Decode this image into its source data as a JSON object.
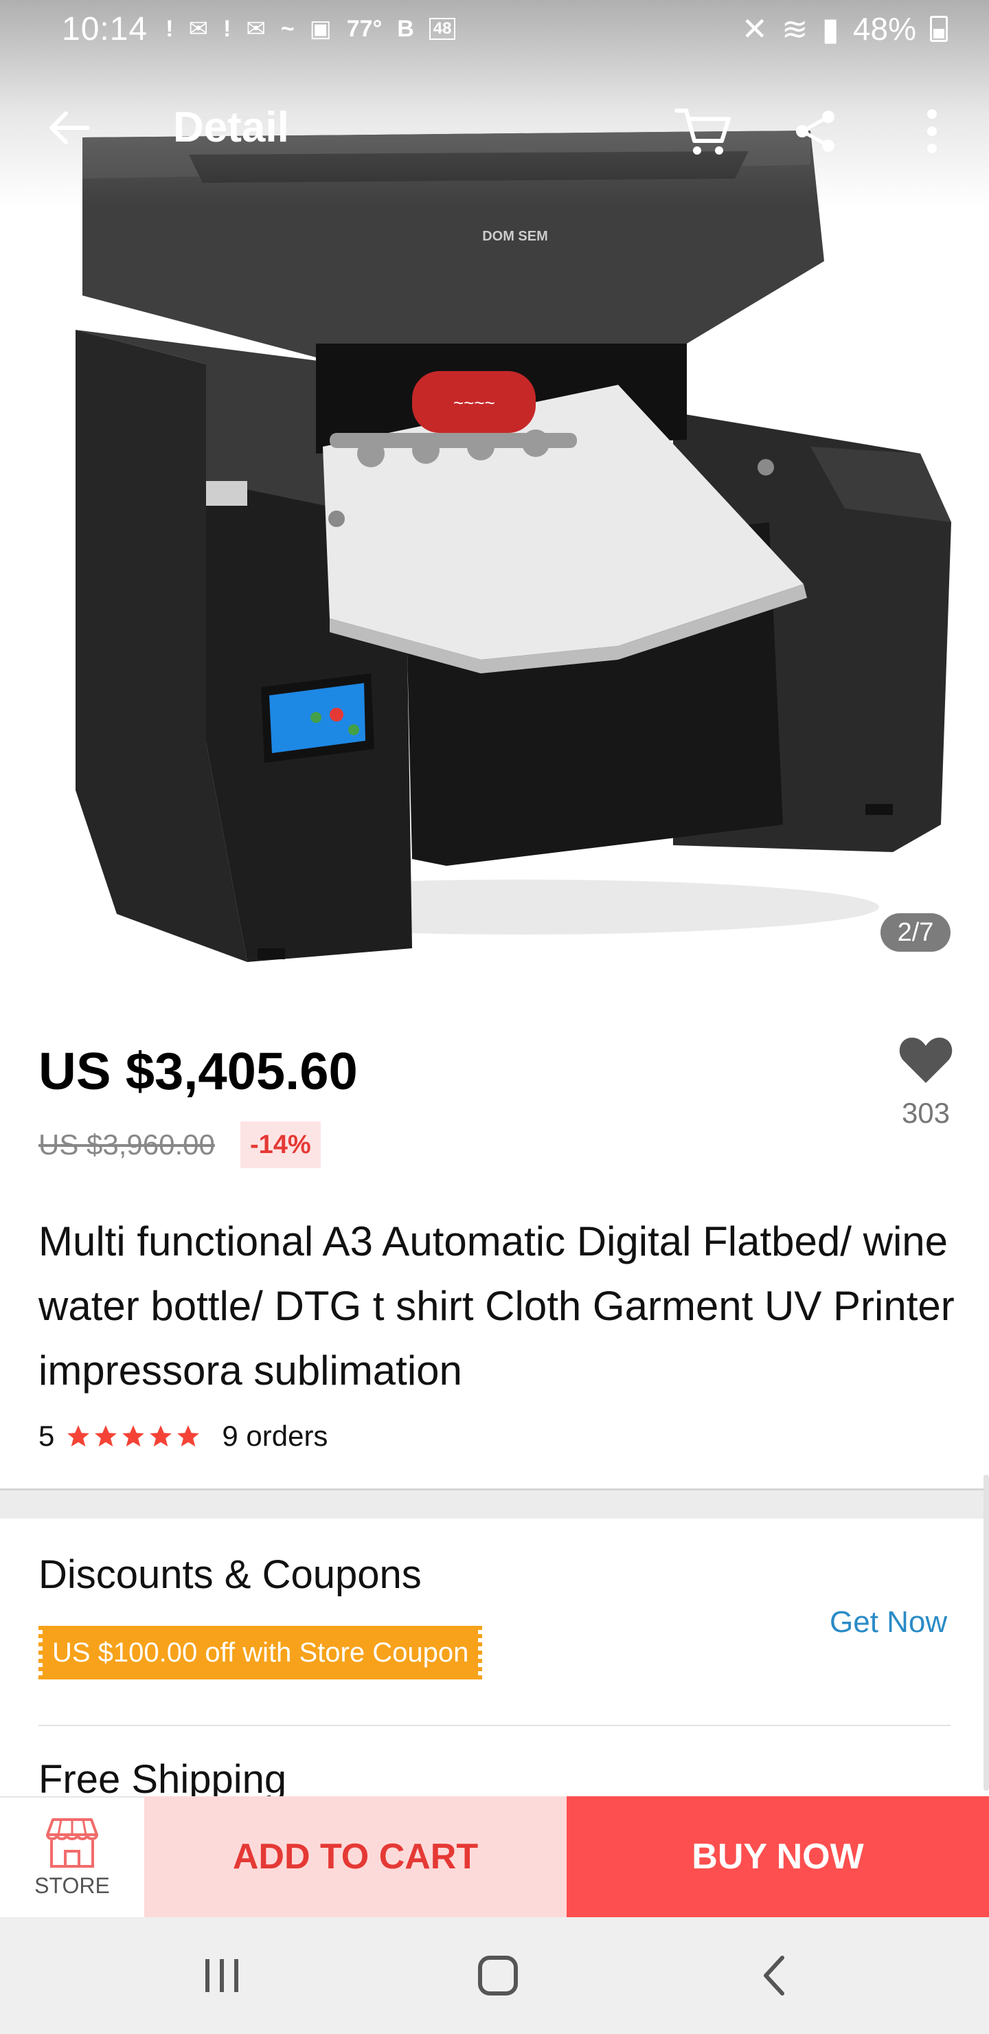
{
  "status_bar": {
    "time": "10:14",
    "weather": "77°",
    "b_label": "B",
    "box_label": "48",
    "battery": "48%"
  },
  "app_bar": {
    "title": "Detail"
  },
  "gallery": {
    "counter": "2/7",
    "brand_label": "DOM SEM"
  },
  "product": {
    "price": "US $3,405.60",
    "original_price": "US $3,960.00",
    "discount": "-14%",
    "wishlist_count": "303",
    "title": "Multi functional A3 Automatic Digital Flatbed/ wine water bottle/ DTG t shirt Cloth Garment UV Printer impressora sublimation",
    "rating": "5",
    "star_count": 5,
    "orders": "9 orders"
  },
  "coupons": {
    "title": "Discounts & Coupons",
    "coupon_text": "US $100.00 off with Store Coupon",
    "action": "Get Now"
  },
  "shipping": {
    "title": "Free Shipping"
  },
  "action_bar": {
    "store_label": "STORE",
    "add_to_cart": "ADD TO CART",
    "buy_now": "BUY NOW"
  },
  "colors": {
    "accent_red": "#fd4f4f",
    "add_cart_bg": "#fddada",
    "coupon_orange": "#f7a21a",
    "link_blue": "#2a8bc6"
  }
}
